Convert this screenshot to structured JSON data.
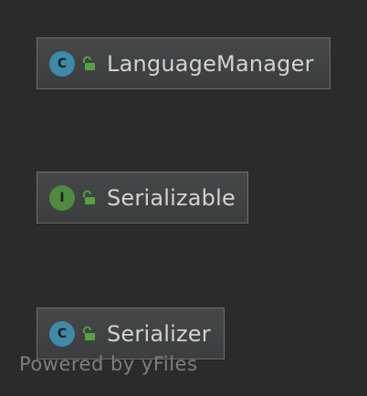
{
  "diagram": {
    "nodes": [
      {
        "kind": "class",
        "kind_letter": "C",
        "icon": "class-icon",
        "visibility_icon": "unlocked-padlock-icon",
        "label": "LanguageManager"
      },
      {
        "kind": "interface",
        "kind_letter": "I",
        "icon": "interface-icon",
        "visibility_icon": "unlocked-padlock-icon",
        "label": "Serializable"
      },
      {
        "kind": "class",
        "kind_letter": "C",
        "icon": "class-icon",
        "visibility_icon": "unlocked-padlock-icon",
        "label": "Serializer"
      }
    ],
    "colors": {
      "background": "#2b2b2b",
      "node_fill": "#414344",
      "node_border": "#6f6f6f",
      "class_icon": "#3f8aa8",
      "interface_icon": "#4f8a3e",
      "lock_icon": "#57a043",
      "label_text": "#d2d2d2",
      "watermark_text": "#7f7f7f"
    },
    "watermark": "Powered by yFiles"
  }
}
